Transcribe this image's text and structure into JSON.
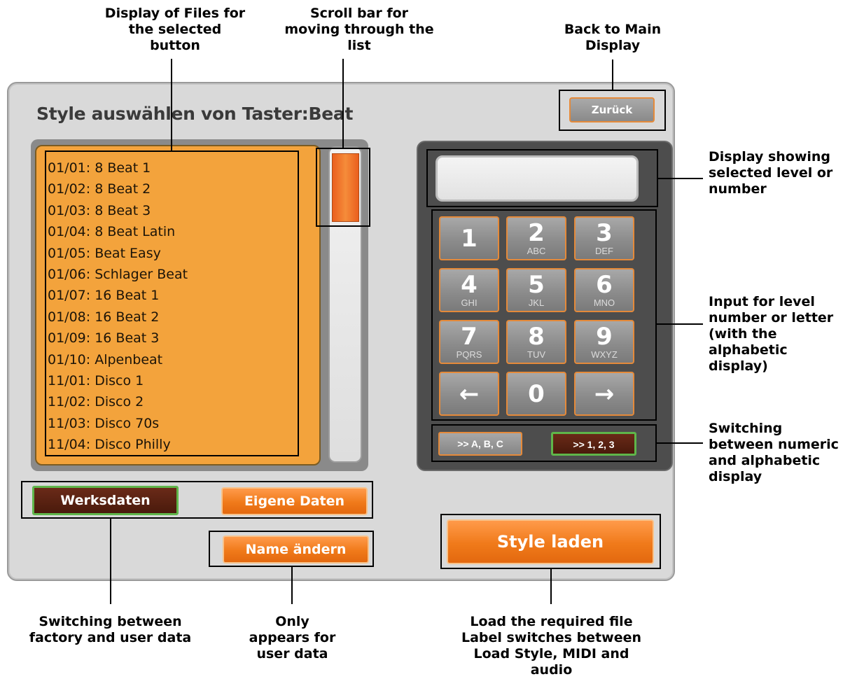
{
  "annotations": {
    "files_display": "Display of Files for\nthe selected\nbutton",
    "scroll_bar": "Scroll bar for\nmoving through the\nlist",
    "back": "Back to Main\nDisplay",
    "display_level": "Display showing\nselected level or\nnumber",
    "input_level": "Input for level\nnumber or letter\n(with the\nalphabetic\ndisplay)",
    "switch_display": "Switching\nbetween numeric\nand alphabetic\ndisplay",
    "switch_data": "Switching between\nfactory and user data",
    "only_user": "Only\nappears for\nuser data",
    "load_file": "Load the required file\nLabel switches between\nLoad Style, MIDI and\naudio"
  },
  "ui": {
    "title": "Style auswählen von Taster:Beat",
    "back_button": "Zurück",
    "display_value": "",
    "files": [
      "01/01: 8 Beat 1",
      "01/02: 8 Beat 2",
      "01/03: 8 Beat 3",
      "01/04: 8 Beat Latin",
      "01/05: Beat Easy",
      "01/06: Schlager Beat",
      "01/07: 16 Beat 1",
      "01/08: 16 Beat 2",
      "01/09: 16 Beat 3",
      "01/10: Alpenbeat",
      "11/01: Disco 1",
      "11/02: Disco 2",
      "11/03: Disco 70s",
      "11/04: Disco Philly"
    ],
    "scroll_position": 0.0,
    "keys": [
      {
        "main": "1",
        "sub": ""
      },
      {
        "main": "2",
        "sub": "ABC"
      },
      {
        "main": "3",
        "sub": "DEF"
      },
      {
        "main": "4",
        "sub": "GHI"
      },
      {
        "main": "5",
        "sub": "JKL"
      },
      {
        "main": "6",
        "sub": "MNO"
      },
      {
        "main": "7",
        "sub": "PQRS"
      },
      {
        "main": "8",
        "sub": "TUV"
      },
      {
        "main": "9",
        "sub": "WXYZ"
      },
      {
        "main": "←",
        "sub": ""
      },
      {
        "main": "0",
        "sub": ""
      },
      {
        "main": "→",
        "sub": ""
      }
    ],
    "alpha_button": ">> A, B, C",
    "numeric_button": ">> 1, 2, 3",
    "factory_button": "Werksdaten",
    "user_button": "Eigene Daten",
    "rename_button": "Name ändern",
    "load_button": "Style laden"
  },
  "colors": {
    "accent_orange": "#f07a1a",
    "list_background": "#f3a33c",
    "selected_dark": "#4a1a0c",
    "selected_border": "#5fb64a",
    "keypad_background": "#4d4d4d"
  }
}
